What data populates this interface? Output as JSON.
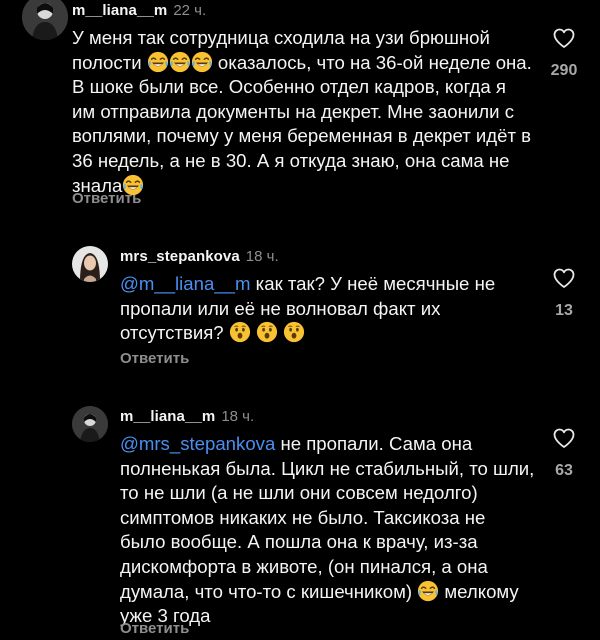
{
  "comments": [
    {
      "username": "m__liana__m",
      "time": "22 ч.",
      "text_parts": [
        "У меня так сотрудница сходила на узи брюшной полости ",
        " оказалось, что на 36-ой неделе она. В шоке были все. Особенно отдел кадров, когда я им отправила документы на декрет. Мне заонили с воплями, почему у меня беременная в декрет идёт в 36 недель, а не в 30. А я откуда знаю, она сама не знала"
      ],
      "emojis": [
        "laughing-tears",
        "laughing-tears",
        "laughing-tears",
        "laughing-tears"
      ],
      "reply_label": "Ответить",
      "likes": "290"
    },
    {
      "username": "mrs_stepankova",
      "time": "18 ч.",
      "mention": "@m__liana__m",
      "text_parts": [
        " как так? У неё месячные не пропали или её не волновал факт их отсутствия? "
      ],
      "emojis": [
        "astonished",
        "astonished",
        "astonished"
      ],
      "reply_label": "Ответить",
      "likes": "13"
    },
    {
      "username": "m__liana__m",
      "time": "18 ч.",
      "mention": "@mrs_stepankova",
      "text_parts": [
        " не пропали. Сама она полненькая была. Цикл не стабильный, то шли, то не шли (а не шли они совсем недолго) симптомов никаких не было. Таксикоза не было вообще. А пошла она к врачу,  из-за дискомфорта в животе, (он пинался, а она думала, что что-то с кишечником) ",
        "  мелкому уже 3 года"
      ],
      "emojis": [
        "laughing-tears"
      ],
      "reply_label": "Ответить",
      "likes": "63"
    }
  ],
  "icons": {
    "like": "heart-outline-icon"
  },
  "colors": {
    "background": "#000000",
    "mention": "#4a8ff0",
    "muted": "#8e8e8e"
  }
}
